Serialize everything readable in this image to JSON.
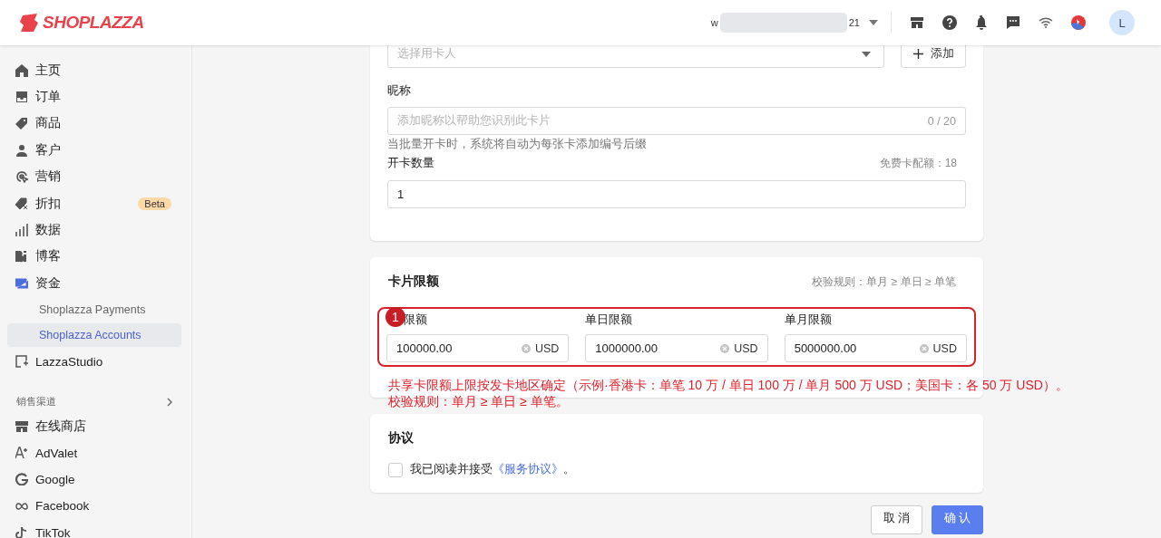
{
  "header": {
    "logo": "SHOPLAZZA",
    "store_name_start": "w",
    "store_name_end": "21",
    "avatar_initial": "L"
  },
  "sidebar": {
    "items": [
      {
        "label": "主页",
        "selected": false
      },
      {
        "label": "订单",
        "selected": false
      },
      {
        "label": "商品",
        "selected": false
      },
      {
        "label": "客户",
        "selected": false
      },
      {
        "label": "营销",
        "selected": false
      },
      {
        "label": "折扣",
        "selected": false,
        "badge": "Beta"
      },
      {
        "label": "数据",
        "selected": false
      },
      {
        "label": "博客",
        "selected": false
      },
      {
        "label": "资金",
        "selected": false,
        "children": [
          {
            "label": "Shoplazza Payments",
            "selected": false
          },
          {
            "label": "Shoplazza Accounts",
            "selected": true
          }
        ]
      },
      {
        "label": "LazzaStudio",
        "selected": false
      }
    ],
    "section": {
      "title": "销售渠道",
      "items": [
        {
          "label": "在线商店",
          "selected": false
        },
        {
          "label": "AdValet",
          "selected": false
        },
        {
          "label": "Google",
          "selected": false
        },
        {
          "label": "Facebook",
          "selected": false
        },
        {
          "label": "TikTok",
          "selected": false
        }
      ]
    }
  },
  "card_form": {
    "cardholder_select": {
      "placeholder": "选择用卡人"
    },
    "add_button": "添加",
    "nickname": {
      "label": "昵称",
      "placeholder": "添加昵称以帮助您识别此卡片",
      "counter": "0 / 20",
      "hint": "当批量开卡时，系统将自动为每张卡添加编号后缀"
    },
    "quantity": {
      "label": "开卡数量",
      "quota": "免费卡配额：18",
      "value": "1"
    }
  },
  "limits": {
    "title": "卡片限额",
    "rule": "校验规则：单月 ≥ 单日 ≥ 单笔",
    "fields": [
      {
        "label": "限额",
        "value": "100000.00",
        "unit": "USD"
      },
      {
        "label": "单日限额",
        "value": "1000000.00",
        "unit": "USD"
      },
      {
        "label": "单月限额",
        "value": "5000000.00",
        "unit": "USD"
      }
    ]
  },
  "annotation": {
    "number": "1",
    "lines": [
      "共享卡限额上限按发卡地区确定（示例·香港卡：单笔 10 万 / 单日 100 万 / 单月 500 万 USD；美国卡：各 50 万 USD）。",
      "校验规则：单月 ≥ 单日 ≥ 单笔。"
    ]
  },
  "agreement": {
    "title": "协议",
    "checked": false,
    "text": "我已阅读并接受",
    "link": "《服务协议》",
    "suffix": "。"
  },
  "buttons": [
    {
      "label": "取 消",
      "kind": "secondary"
    },
    {
      "label": "确 认",
      "kind": "primary"
    }
  ]
}
